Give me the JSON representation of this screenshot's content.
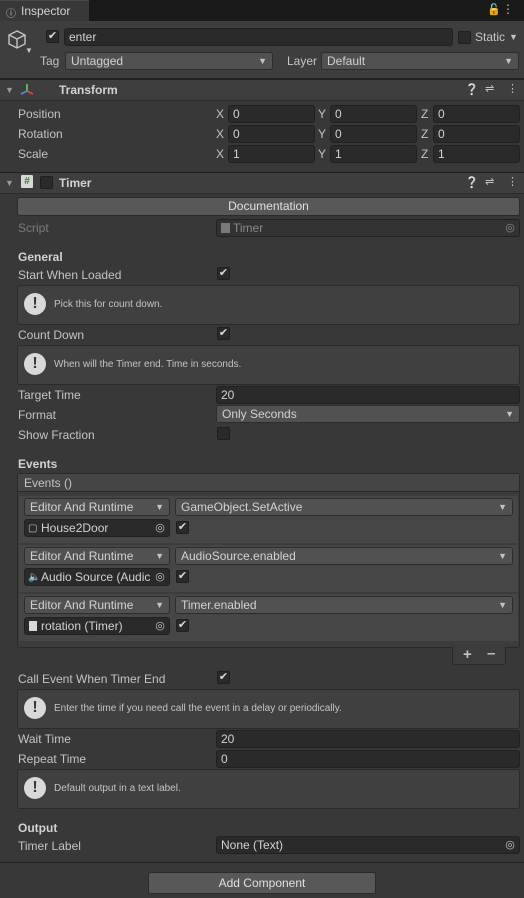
{
  "tab": {
    "label": "Inspector"
  },
  "header": {
    "name": "enter",
    "static_label": "Static",
    "tag_label": "Tag",
    "tag_value": "Untagged",
    "layer_label": "Layer",
    "layer_value": "Default"
  },
  "transform": {
    "title": "Transform",
    "rows": [
      {
        "label": "Position",
        "x": "0",
        "y": "0",
        "z": "0"
      },
      {
        "label": "Rotation",
        "x": "0",
        "y": "0",
        "z": "0"
      },
      {
        "label": "Scale",
        "x": "1",
        "y": "1",
        "z": "1"
      }
    ],
    "axis": {
      "x": "X",
      "y": "Y",
      "z": "Z"
    }
  },
  "timer": {
    "title": "Timer",
    "documentation": "Documentation",
    "script_label": "Script",
    "script_value": "Timer",
    "general_heading": "General",
    "start_when_loaded": "Start When Loaded",
    "help1": "Pick this for count down.",
    "count_down": "Count Down",
    "help2": "When will the Timer end. Time in seconds.",
    "target_time_label": "Target Time",
    "target_time_value": "20",
    "format_label": "Format",
    "format_value": "Only Seconds",
    "show_fraction": "Show Fraction",
    "events_heading": "Events",
    "events_list_title": "Events ()",
    "events": [
      {
        "mode": "Editor And Runtime",
        "function": "GameObject.SetActive",
        "object": "House2Door"
      },
      {
        "mode": "Editor And Runtime",
        "function": "AudioSource.enabled",
        "object": "Audio Source (Audic"
      },
      {
        "mode": "Editor And Runtime",
        "function": "Timer.enabled",
        "object": "rotation (Timer)"
      }
    ],
    "call_event_label": "Call Event When Timer End",
    "help3": "Enter the time if you need call the event in a delay or periodically.",
    "wait_time_label": "Wait Time",
    "wait_time_value": "20",
    "repeat_time_label": "Repeat Time",
    "repeat_time_value": "0",
    "help4": "Default output in a text label.",
    "output_heading": "Output",
    "timer_label_label": "Timer Label",
    "timer_label_value": "None (Text)"
  },
  "add_component": "Add Component"
}
